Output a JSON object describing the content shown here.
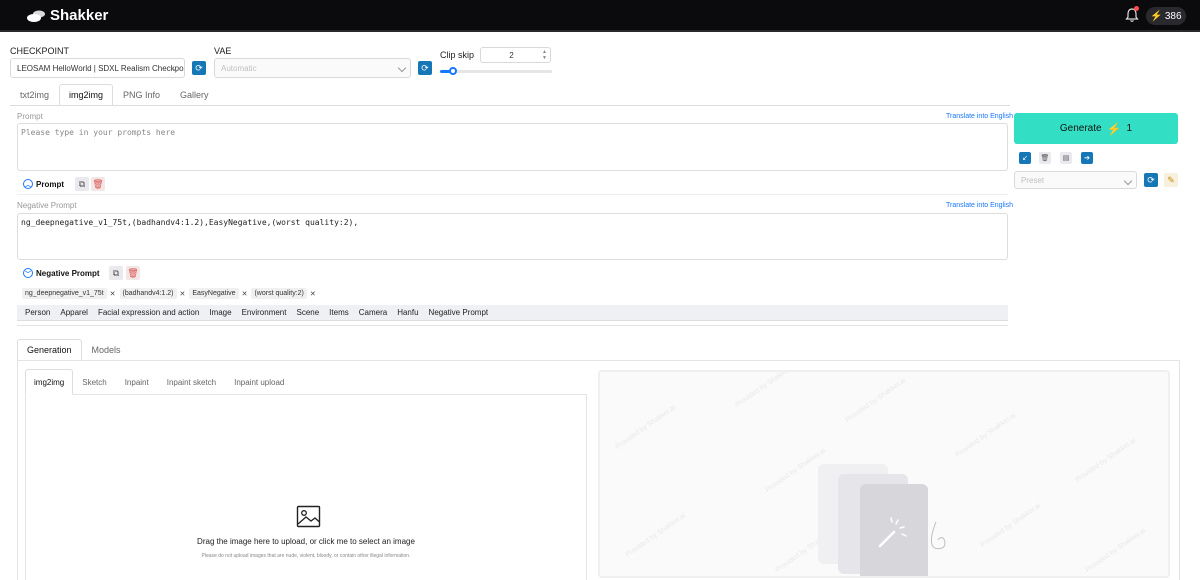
{
  "topbar": {
    "brand": "Shakker",
    "credits": "386"
  },
  "checkpoint": {
    "label": "CHECKPOINT",
    "value": "LEOSAM HelloWorld | SDXL Realism Checkpoint"
  },
  "vae": {
    "label": "VAE",
    "value": "Automatic"
  },
  "clip_skip": {
    "label": "Clip skip",
    "value": "2",
    "slider_fraction": 0.12
  },
  "main_tabs": [
    {
      "label": "txt2img"
    },
    {
      "label": "img2img"
    },
    {
      "label": "PNG Info"
    },
    {
      "label": "Gallery"
    }
  ],
  "prompt": {
    "title": "Prompt",
    "translate": "Translate into English",
    "placeholder": "Please type in your prompts here",
    "toggle": "Prompt"
  },
  "negative": {
    "title": "Negative Prompt",
    "translate": "Translate into English",
    "value": "ng_deepnegative_v1_75t,(badhandv4:1.2),EasyNegative,(worst quality:2),",
    "toggle": "Negative Prompt",
    "chips": [
      "ng_deepnegative_v1_75t",
      "(badhandv4:1.2)",
      "EasyNegative",
      "(worst quality:2)"
    ]
  },
  "categories": [
    "Person",
    "Apparel",
    "Facial expression and action",
    "Image",
    "Environment",
    "Scene",
    "Items",
    "Camera",
    "Hanfu",
    "Negative Prompt"
  ],
  "generate": {
    "label": "Generate",
    "cost": "1"
  },
  "preset": {
    "placeholder": "Preset"
  },
  "section_tabs": [
    {
      "label": "Generation"
    },
    {
      "label": "Models"
    }
  ],
  "sub_tabs": [
    {
      "label": "img2img"
    },
    {
      "label": "Sketch"
    },
    {
      "label": "Inpaint"
    },
    {
      "label": "Inpaint sketch"
    },
    {
      "label": "Inpaint upload"
    }
  ],
  "upload": {
    "text": "Drag the image here to upload, or click me to select an image",
    "note": "Please do not upload images that are nude, violent, bloody, or contain other illegal information."
  },
  "output": {
    "watermark": "Provided by Shakker.ai"
  }
}
